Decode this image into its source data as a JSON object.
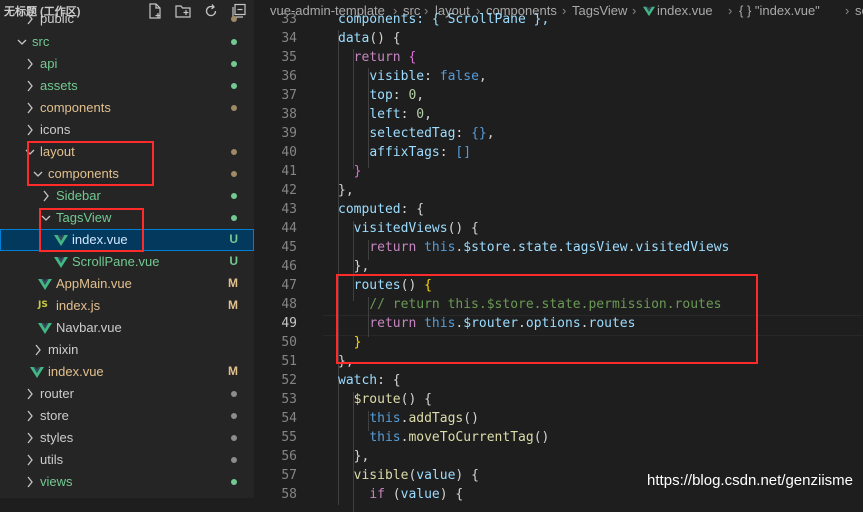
{
  "explorer": {
    "title": "无标题 (工作区)",
    "actions": [
      "new-file-icon",
      "new-folder-icon",
      "refresh-icon",
      "collapse-all-icon"
    ],
    "items": [
      {
        "label": "public",
        "kind": "folder",
        "state": "collapsed",
        "status": "dot"
      },
      {
        "label": "src",
        "kind": "folder",
        "state": "expanded",
        "status": "dot"
      },
      {
        "label": "api",
        "kind": "folder",
        "state": "collapsed",
        "status": "dot"
      },
      {
        "label": "assets",
        "kind": "folder",
        "state": "collapsed",
        "status": "dot"
      },
      {
        "label": "components",
        "kind": "folder",
        "state": "collapsed",
        "status": "dot"
      },
      {
        "label": "icons",
        "kind": "folder",
        "state": "collapsed",
        "status": ""
      },
      {
        "label": "layout",
        "kind": "folder",
        "state": "expanded",
        "status": "dot"
      },
      {
        "label": "components",
        "kind": "folder",
        "state": "expanded",
        "status": "dot"
      },
      {
        "label": "Sidebar",
        "kind": "folder",
        "state": "collapsed",
        "status": "dot"
      },
      {
        "label": "TagsView",
        "kind": "folder",
        "state": "expanded",
        "status": "dot"
      },
      {
        "label": "index.vue",
        "kind": "vue",
        "state": "",
        "status": "U"
      },
      {
        "label": "ScrollPane.vue",
        "kind": "vue",
        "state": "",
        "status": "U"
      },
      {
        "label": "AppMain.vue",
        "kind": "vue",
        "state": "",
        "status": "M"
      },
      {
        "label": "index.js",
        "kind": "js",
        "state": "",
        "status": "M"
      },
      {
        "label": "Navbar.vue",
        "kind": "vue",
        "state": "",
        "status": ""
      },
      {
        "label": "mixin",
        "kind": "folder",
        "state": "collapsed",
        "status": ""
      },
      {
        "label": "index.vue",
        "kind": "vue",
        "state": "",
        "status": "M"
      },
      {
        "label": "router",
        "kind": "folder",
        "state": "collapsed",
        "status": "dot"
      },
      {
        "label": "store",
        "kind": "folder",
        "state": "collapsed",
        "status": "dot"
      },
      {
        "label": "styles",
        "kind": "folder",
        "state": "collapsed",
        "status": "dot"
      },
      {
        "label": "utils",
        "kind": "folder",
        "state": "collapsed",
        "status": "dot"
      },
      {
        "label": "views",
        "kind": "folder",
        "state": "collapsed",
        "status": "dot"
      }
    ]
  },
  "breadcrumb": [
    "vue-admin-template",
    "src",
    "layout",
    "components",
    "TagsView",
    "index.vue",
    "{ } \"index.vue\"",
    "scro"
  ],
  "editor": {
    "top_line_text": "components: { ScrollPane },",
    "lines": [
      {
        "n": "34",
        "html": "<span class='p'>data</span><span>() {</span>"
      },
      {
        "n": "35",
        "html": "<span class='k'>return</span> <span class='br'>{</span>"
      },
      {
        "n": "36",
        "html": "<span class='p'>visible</span>: <span class='b'>false</span>,"
      },
      {
        "n": "37",
        "html": "<span class='p'>top</span>: <span class='n'>0</span>,"
      },
      {
        "n": "38",
        "html": "<span class='p'>left</span>: <span class='n'>0</span>,"
      },
      {
        "n": "39",
        "html": "<span class='p'>selectedTag</span>: <span class='b'>{}</span>,"
      },
      {
        "n": "40",
        "html": "<span class='p'>affixTags</span>: <span class='b'>[]</span>"
      },
      {
        "n": "41",
        "html": "<span class='br'>}</span>"
      },
      {
        "n": "42",
        "html": "},"
      },
      {
        "n": "43",
        "html": "<span class='p'>computed</span>: {"
      },
      {
        "n": "44",
        "html": "<span class='p'>visitedViews</span>() {"
      },
      {
        "n": "45",
        "html": "<span class='k'>return</span> <span class='b'>this</span>.<span class='p'>$store</span>.<span class='p'>state</span>.<span class='p'>tagsView</span>.<span class='p'>visitedViews</span>"
      },
      {
        "n": "46",
        "html": "},"
      },
      {
        "n": "47",
        "html": "<span class='p'>routes</span>() <span class='y'>{</span>"
      },
      {
        "n": "48",
        "html": "<span class='cm'>// return this.$store.state.permission.routes</span>"
      },
      {
        "n": "49",
        "html": "<span class='k'>return</span> <span class='b'>this</span>.<span class='p'>$router</span>.<span class='p'>options</span>.<span class='p'>routes</span>"
      },
      {
        "n": "50",
        "html": "<span class='y'>}</span>"
      },
      {
        "n": "51",
        "html": "},"
      },
      {
        "n": "52",
        "html": "<span class='p'>watch</span>: {"
      },
      {
        "n": "53",
        "html": "<span class='f'>$route</span>() {"
      },
      {
        "n": "54",
        "html": "<span class='b'>this</span>.<span class='f'>addTags</span>()"
      },
      {
        "n": "55",
        "html": "<span class='b'>this</span>.<span class='f'>moveToCurrentTag</span>()"
      },
      {
        "n": "56",
        "html": "},"
      },
      {
        "n": "57",
        "html": "<span class='f'>visible</span>(<span class='p'>value</span>) {"
      },
      {
        "n": "58",
        "html": "<span class='k'>if</span> (<span class='p'>value</span>) {"
      }
    ]
  },
  "watermark": "https://blog.csdn.net/genziisme",
  "colors": {
    "annotation": "#ff2a2a",
    "untracked": "#73c991",
    "modified": "#e2c08d"
  }
}
